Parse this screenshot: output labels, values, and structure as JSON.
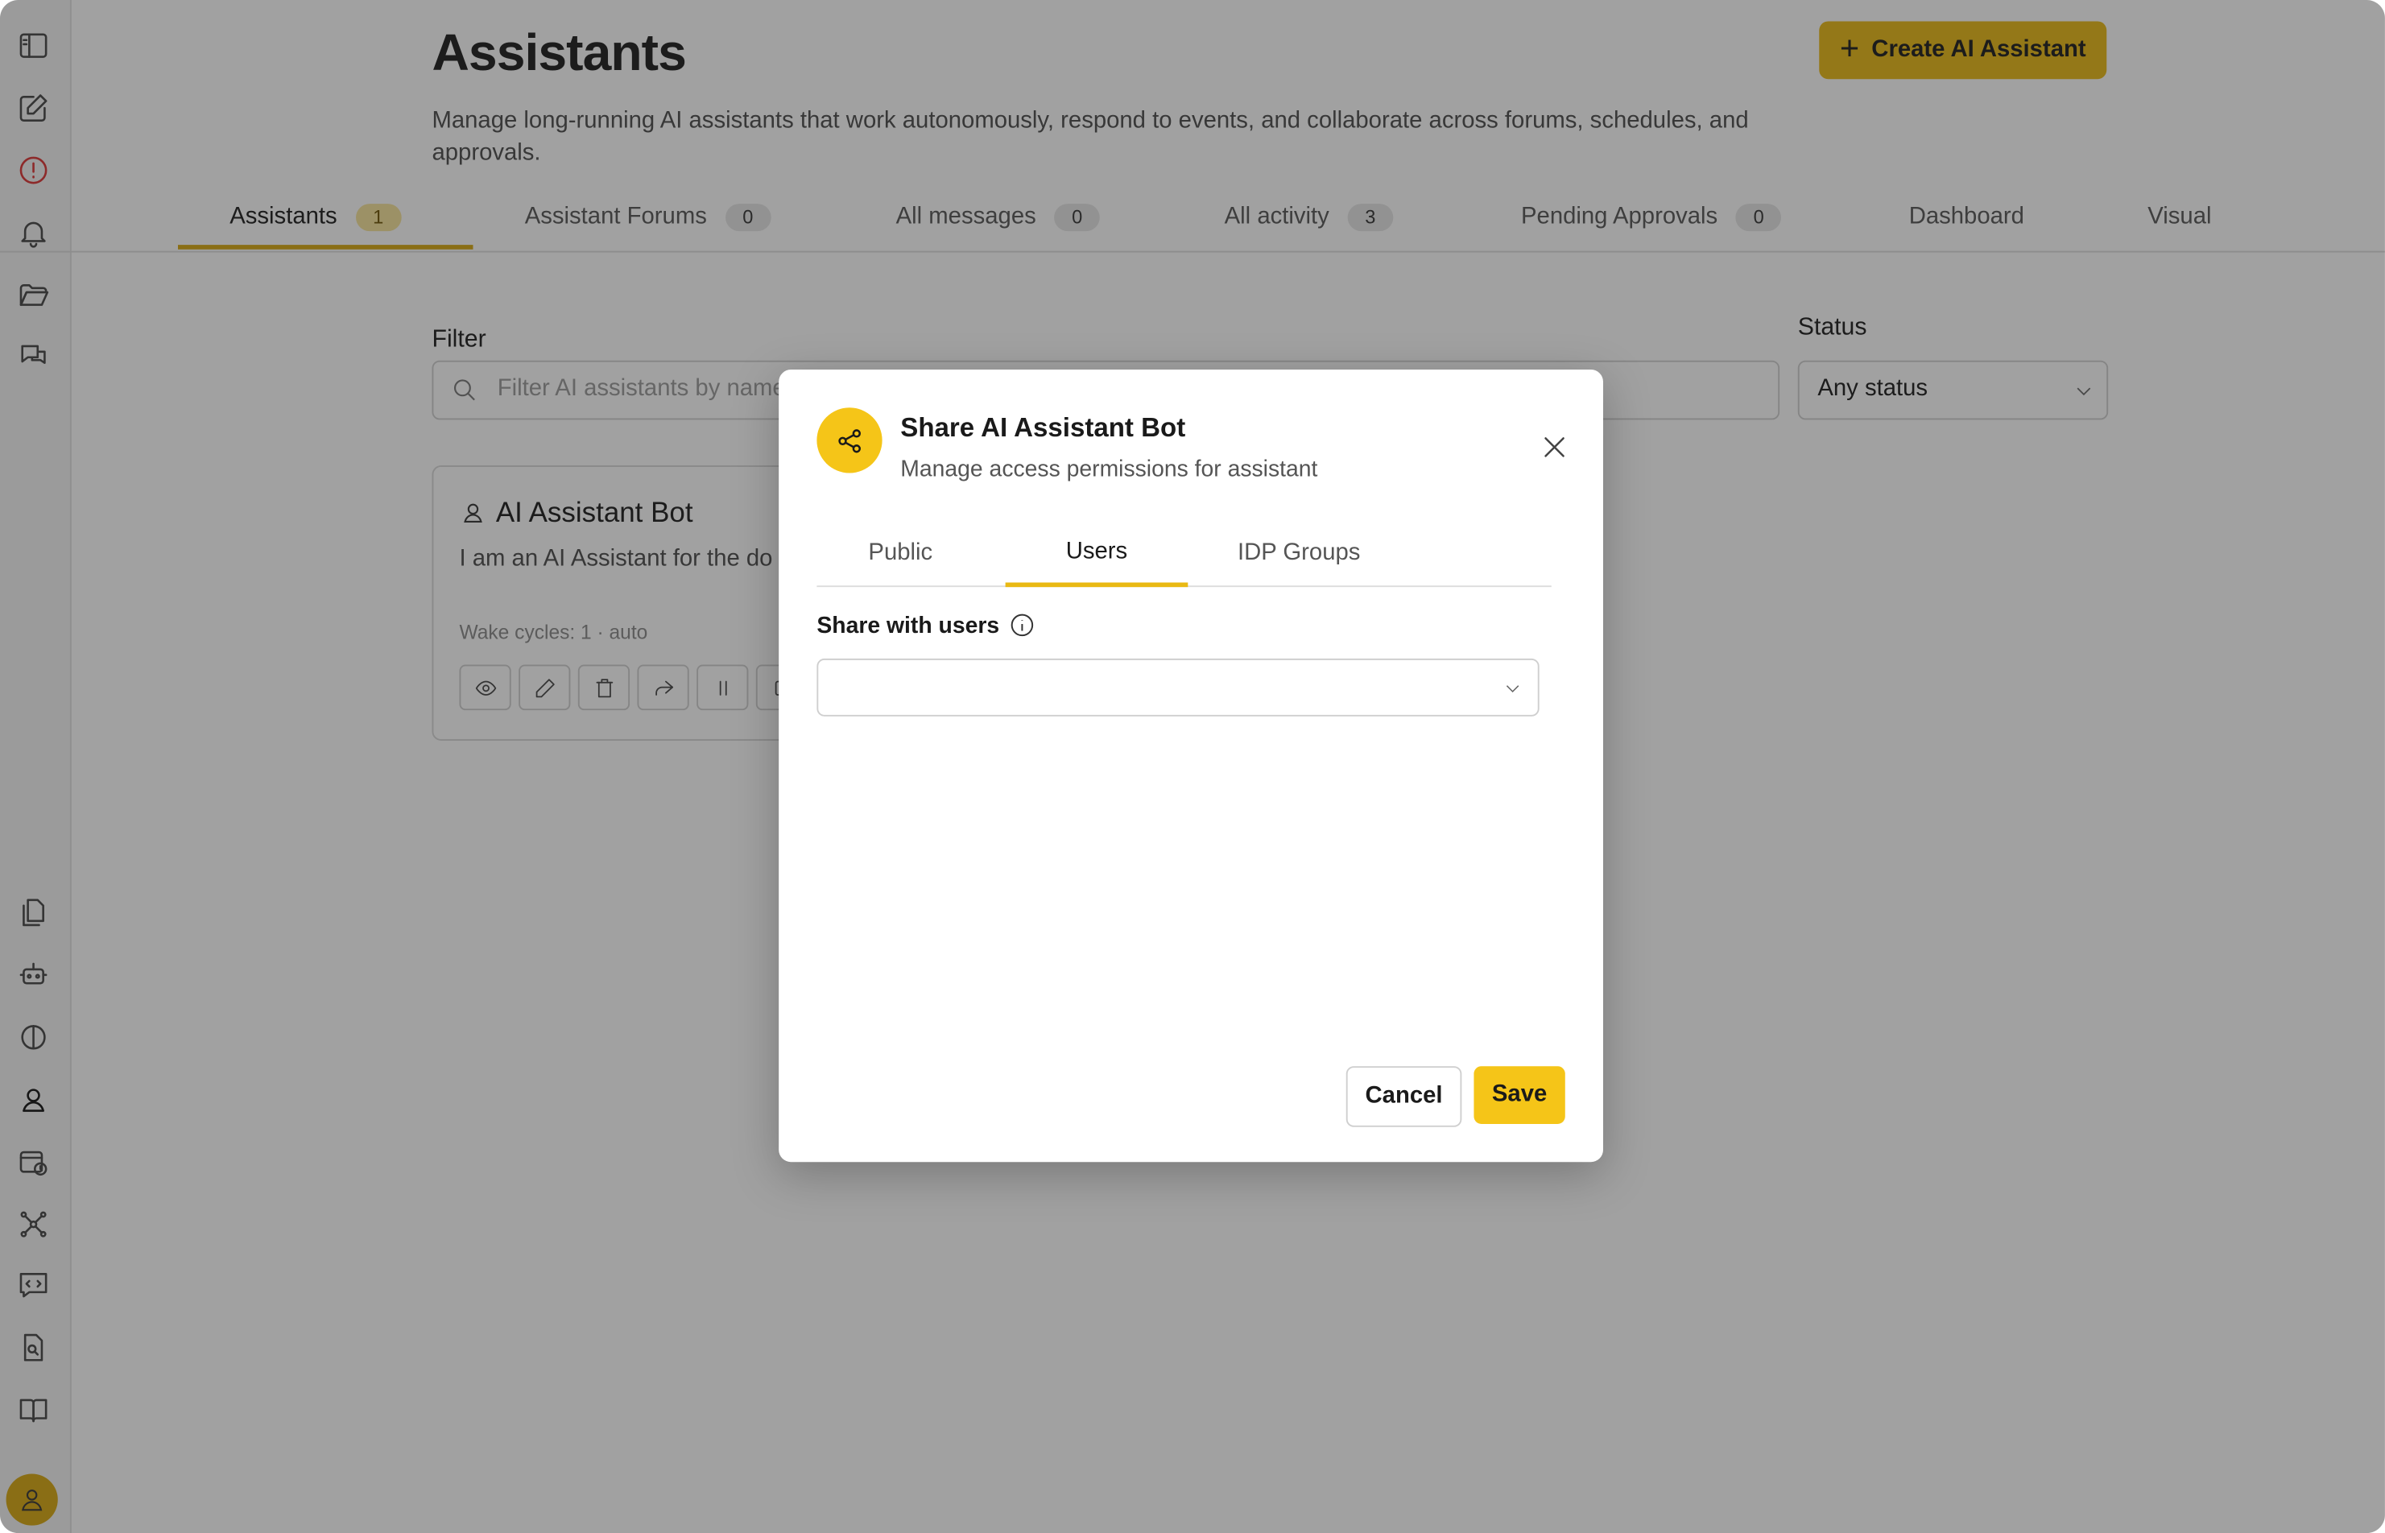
{
  "header": {
    "title": "Assistants",
    "description": "Manage long-running AI assistants that work autonomously, respond to events, and collaborate across forums, schedules, and approvals.",
    "create_label": "Create AI Assistant"
  },
  "tabs": [
    {
      "label": "Assistants",
      "count": "1"
    },
    {
      "label": "Assistant Forums",
      "count": "0"
    },
    {
      "label": "All messages",
      "count": "0"
    },
    {
      "label": "All activity",
      "count": "3"
    },
    {
      "label": "Pending Approvals",
      "count": "0"
    },
    {
      "label": "Dashboard"
    },
    {
      "label": "Visual"
    }
  ],
  "filter": {
    "label": "Filter",
    "placeholder": "Filter AI assistants by name"
  },
  "status": {
    "label": "Status",
    "value": "Any status"
  },
  "card": {
    "title": "AI Assistant Bot",
    "description": "I am an AI Assistant for the do team.",
    "meta": "Wake cycles: 1 · auto"
  },
  "modal": {
    "title": "Share AI Assistant Bot",
    "subtitle": "Manage access permissions for assistant",
    "tabs": [
      "Public",
      "Users",
      "IDP Groups"
    ],
    "share_label": "Share with users",
    "cancel_label": "Cancel",
    "save_label": "Save"
  },
  "colors": {
    "accent": "#f5c518",
    "overlay": "rgba(30,30,30,0.42)"
  }
}
